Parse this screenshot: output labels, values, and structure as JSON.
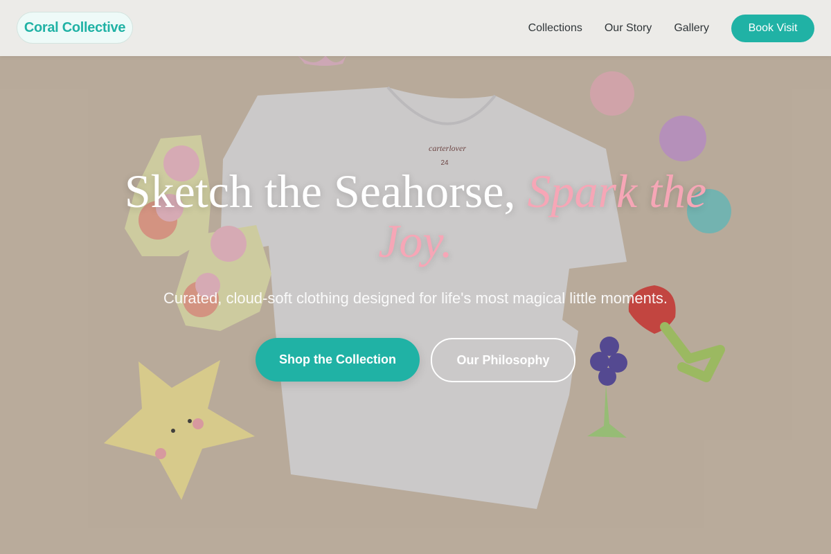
{
  "header": {
    "brand": "Coral Collective",
    "nav": [
      {
        "label": "Collections"
      },
      {
        "label": "Our Story"
      },
      {
        "label": "Gallery"
      }
    ],
    "cta": "Book Visit"
  },
  "hero": {
    "title_plain": "Sketch the Seahorse, ",
    "title_accent": "Spark the Joy.",
    "subtitle": "Curated, cloud-soft clothing designed for life's most magical little moments.",
    "primary_button": "Shop the Collection",
    "secondary_button": "Our Philosophy",
    "shirt_tag_brand": "carterlover",
    "shirt_tag_size": "24"
  },
  "colors": {
    "accent_teal": "#20b2a5",
    "accent_pink": "#f6a6b6",
    "background_beige": "#cbbcaa"
  },
  "icons": [
    "star-toy-icon",
    "grape-teether-icon",
    "strawberry-teether-icon",
    "sock-icon",
    "macaron-icon"
  ]
}
